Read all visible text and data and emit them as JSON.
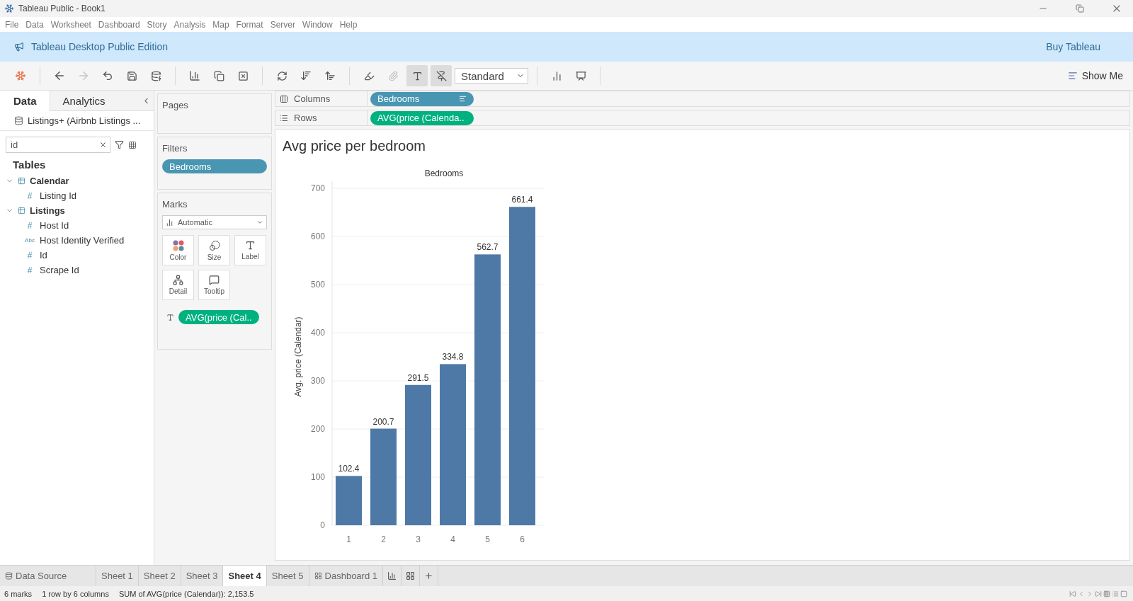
{
  "window": {
    "title": "Tableau Public - Book1"
  },
  "menu": [
    "File",
    "Data",
    "Worksheet",
    "Dashboard",
    "Story",
    "Analysis",
    "Map",
    "Format",
    "Server",
    "Window",
    "Help"
  ],
  "banner": {
    "text": "Tableau Desktop Public Edition",
    "link": "Buy Tableau"
  },
  "toolbar": {
    "redo": {
      "disabled": true
    },
    "annotate": {
      "disabled": true
    },
    "show_labels": {
      "pressed": true
    },
    "fix_axes": {
      "pressed": true
    },
    "view_size": "Standard",
    "show_me": "Show Me"
  },
  "side_tabs": [
    {
      "label": "Data",
      "selected": true
    },
    {
      "label": "Analytics",
      "selected": false
    }
  ],
  "data_source": "Listings+ (Airbnb Listings ...",
  "search": {
    "value": "id"
  },
  "tables_heading": "Tables",
  "tables": [
    {
      "name": "Calendar",
      "expanded": true,
      "children": [
        {
          "type_glyph": "#",
          "name": "Listing Id"
        }
      ]
    },
    {
      "name": "Listings",
      "expanded": true,
      "children": [
        {
          "type_glyph": "#",
          "name": "Host Id"
        },
        {
          "type_glyph": "Abc",
          "name": "Host Identity Verified"
        },
        {
          "type_glyph": "#",
          "name": "Id"
        },
        {
          "type_glyph": "#",
          "name": "Scrape Id"
        }
      ]
    }
  ],
  "pages": {
    "title": "Pages"
  },
  "filters": {
    "title": "Filters",
    "pills": [
      {
        "label": "Bedrooms",
        "kind": "dimension"
      }
    ]
  },
  "marks": {
    "title": "Marks",
    "mark_type": "Automatic",
    "cards": [
      {
        "kind": "color",
        "label": "Color"
      },
      {
        "kind": "size",
        "label": "Size"
      },
      {
        "kind": "label",
        "label": "Label"
      },
      {
        "kind": "detail",
        "label": "Detail"
      },
      {
        "kind": "tooltip",
        "label": "Tooltip"
      }
    ],
    "pills": [
      {
        "label": "AVG(price (Cal..",
        "kind": "measure"
      }
    ]
  },
  "shelves": [
    {
      "kind": "columns",
      "label": "Columns",
      "pill": {
        "label": "Bedrooms",
        "kind": "dimension",
        "sorted": true
      }
    },
    {
      "kind": "rows",
      "label": "Rows",
      "pill": {
        "label": "AVG(price (Calenda..",
        "kind": "measure",
        "sorted": false
      }
    }
  ],
  "sheet": {
    "title": "Avg price per bedroom",
    "chart_data": {
      "type": "bar",
      "xlabel": "Bedrooms",
      "ylabel": "Avg. price (Calendar)",
      "categories": [
        "1",
        "2",
        "3",
        "4",
        "5",
        "6"
      ],
      "series": [
        {
          "color": "#4e79a7",
          "values": [
            102.4,
            200.7,
            291.5,
            334.8,
            562.7,
            661.4
          ]
        }
      ],
      "ylim": [
        0,
        700
      ],
      "yticks": [
        0,
        100,
        200,
        300,
        400,
        500,
        600,
        700
      ],
      "data_labels": true,
      "grid": true
    }
  },
  "sheet_tabs": [
    {
      "kind": "datasource",
      "label": "Data Source",
      "selected": false
    },
    {
      "kind": "sheet",
      "label": "Sheet 1",
      "selected": false
    },
    {
      "kind": "sheet",
      "label": "Sheet 2",
      "selected": false
    },
    {
      "kind": "sheet",
      "label": "Sheet 3",
      "selected": false
    },
    {
      "kind": "sheet",
      "label": "Sheet 4",
      "selected": true
    },
    {
      "kind": "sheet",
      "label": "Sheet 5",
      "selected": false
    },
    {
      "kind": "dashboard",
      "label": "Dashboard 1",
      "selected": false
    }
  ],
  "status_bar": [
    "6 marks",
    "1 row by 6 columns",
    "SUM of AVG(price (Calendar)): 2,153.5"
  ]
}
